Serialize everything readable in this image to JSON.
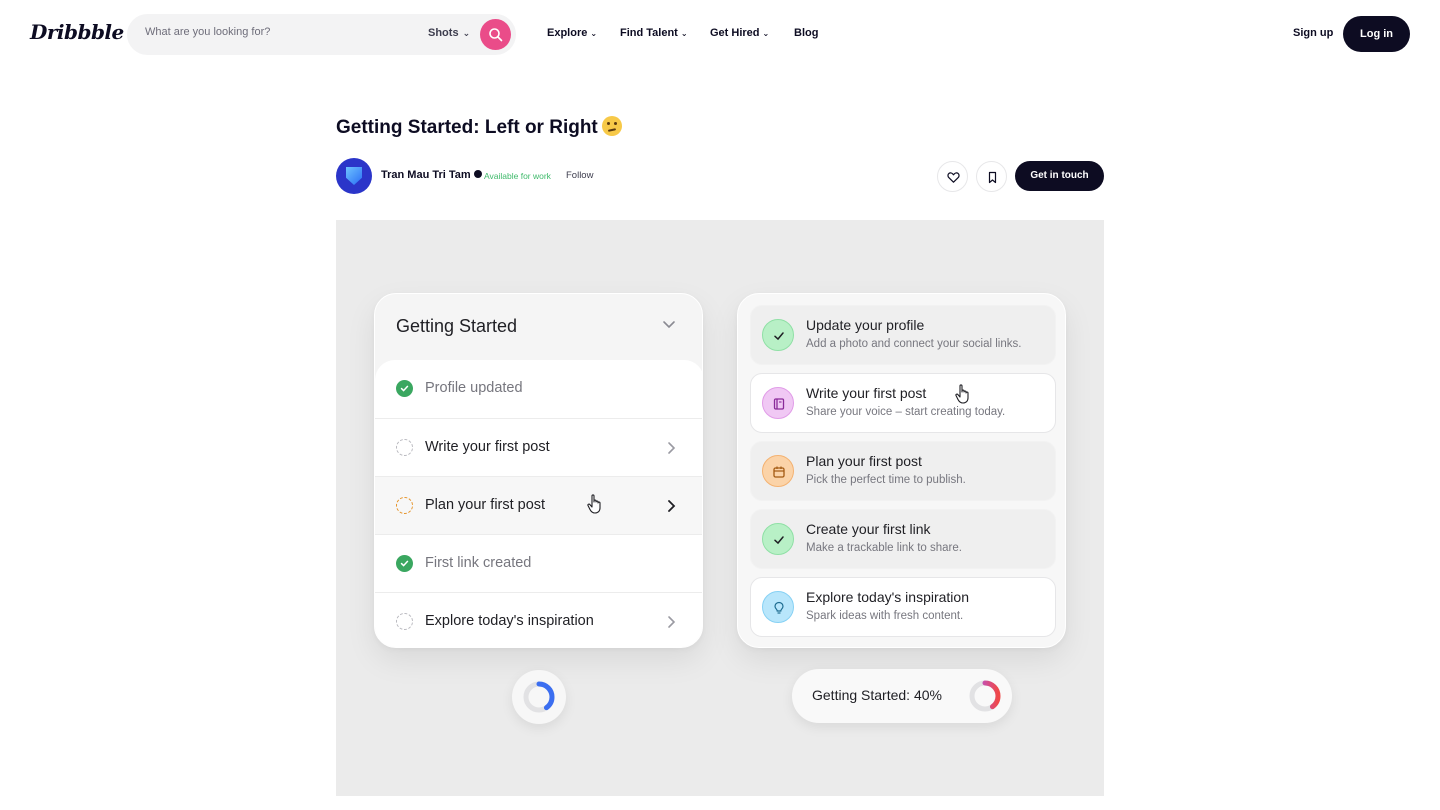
{
  "header": {
    "logo": "Dribbble",
    "search_placeholder": "What are you looking for?",
    "search_type": "Shots",
    "nav": [
      {
        "label": "Explore",
        "has_dropdown": true
      },
      {
        "label": "Find Talent",
        "has_dropdown": true
      },
      {
        "label": "Get Hired",
        "has_dropdown": true
      },
      {
        "label": "Blog",
        "has_dropdown": false
      }
    ],
    "signup": "Sign up",
    "login": "Log in"
  },
  "shot": {
    "title": "Getting Started: Left or Right",
    "author": "Tran Mau Tri Tam",
    "availability": "Available for work",
    "follow": "Follow",
    "cta": "Get in touch"
  },
  "left_card": {
    "title": "Getting Started",
    "items": [
      {
        "label": "Profile updated",
        "status": "done"
      },
      {
        "label": "Write your first post",
        "status": "todo"
      },
      {
        "label": "Plan your first post",
        "status": "active"
      },
      {
        "label": "First link created",
        "status": "done"
      },
      {
        "label": "Explore today's inspiration",
        "status": "todo"
      }
    ],
    "progress": 0.4
  },
  "right_card": {
    "items": [
      {
        "title": "Update your profile",
        "subtitle": "Add a photo and connect your social links.",
        "icon": "check-icon",
        "color": "#b8f0c6"
      },
      {
        "title": "Write your first post",
        "subtitle": "Share your voice – start creating today.",
        "icon": "notebook-icon",
        "color": "#f0c8f4"
      },
      {
        "title": "Plan your first post",
        "subtitle": "Pick the perfect time to publish.",
        "icon": "calendar-icon",
        "color": "#fbd3a8"
      },
      {
        "title": "Create your first link",
        "subtitle": "Make a trackable link to share.",
        "icon": "check-icon",
        "color": "#b8f0c6"
      },
      {
        "title": "Explore today's inspiration",
        "subtitle": "Spark ideas with fresh content.",
        "icon": "lightbulb-icon",
        "color": "#b8e6fb"
      }
    ],
    "progress_label": "Getting Started: 40%",
    "progress": 0.4
  },
  "colors": {
    "brand_pink": "#ea4c89",
    "dark": "#0d0c22",
    "available_green": "#3fba6b"
  }
}
